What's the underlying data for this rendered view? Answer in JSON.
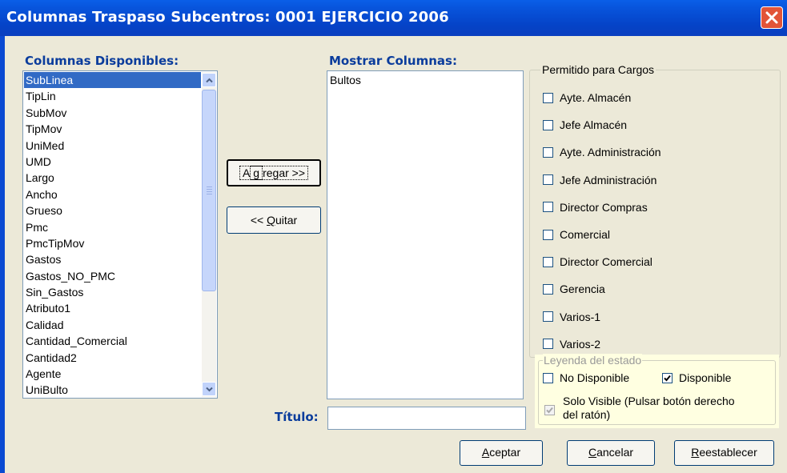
{
  "window": {
    "title": "Columnas Traspaso Subcentros: 0001 EJERCICIO 2006"
  },
  "available": {
    "label": "Columnas Disponibles:",
    "items": [
      "SubLinea",
      "TipLin",
      "SubMov",
      "TipMov",
      "UniMed",
      "UMD",
      "Largo",
      "Ancho",
      "Grueso",
      "Pmc",
      "PmcTipMov",
      "Gastos",
      "Gastos_NO_PMC",
      "Sin_Gastos",
      "Atributo1",
      "Calidad",
      "Cantidad_Comercial",
      "Cantidad2",
      "Agente",
      "UniBulto"
    ],
    "selected": "SubLinea"
  },
  "buttons": {
    "add": "Agregar >>",
    "remove": "<< Quitar",
    "accept": "Aceptar",
    "cancel": "Cancelar",
    "reset": "Reestablecer"
  },
  "shown": {
    "label": "Mostrar Columnas:",
    "items": [
      "Bultos"
    ]
  },
  "title_field": {
    "label": "Título:",
    "value": ""
  },
  "permissions": {
    "label": "Permitido para Cargos",
    "items": [
      {
        "label": "Ayte. Almacén",
        "checked": false
      },
      {
        "label": "Jefe Almacén",
        "checked": false
      },
      {
        "label": "Ayte. Administración",
        "checked": false
      },
      {
        "label": "Jefe Administración",
        "checked": false
      },
      {
        "label": "Director Compras",
        "checked": false
      },
      {
        "label": "Comercial",
        "checked": false
      },
      {
        "label": "Director Comercial",
        "checked": false
      },
      {
        "label": "Gerencia",
        "checked": false
      },
      {
        "label": "Varios-1",
        "checked": false
      },
      {
        "label": "Varios-2",
        "checked": false
      }
    ]
  },
  "legend": {
    "label": "Leyenda del estado",
    "no_disponible": "No Disponible",
    "disponible": "Disponible",
    "solo_visible_1": "Solo Visible (Pulsar botón derecho",
    "solo_visible_2": "del ratón)"
  },
  "colors": {
    "titlebar": "#0855dd",
    "selection": "#316ac5",
    "label_blue": "#0a3c9c",
    "legend_bg": "#ffffe1",
    "face": "#ece9d8"
  }
}
